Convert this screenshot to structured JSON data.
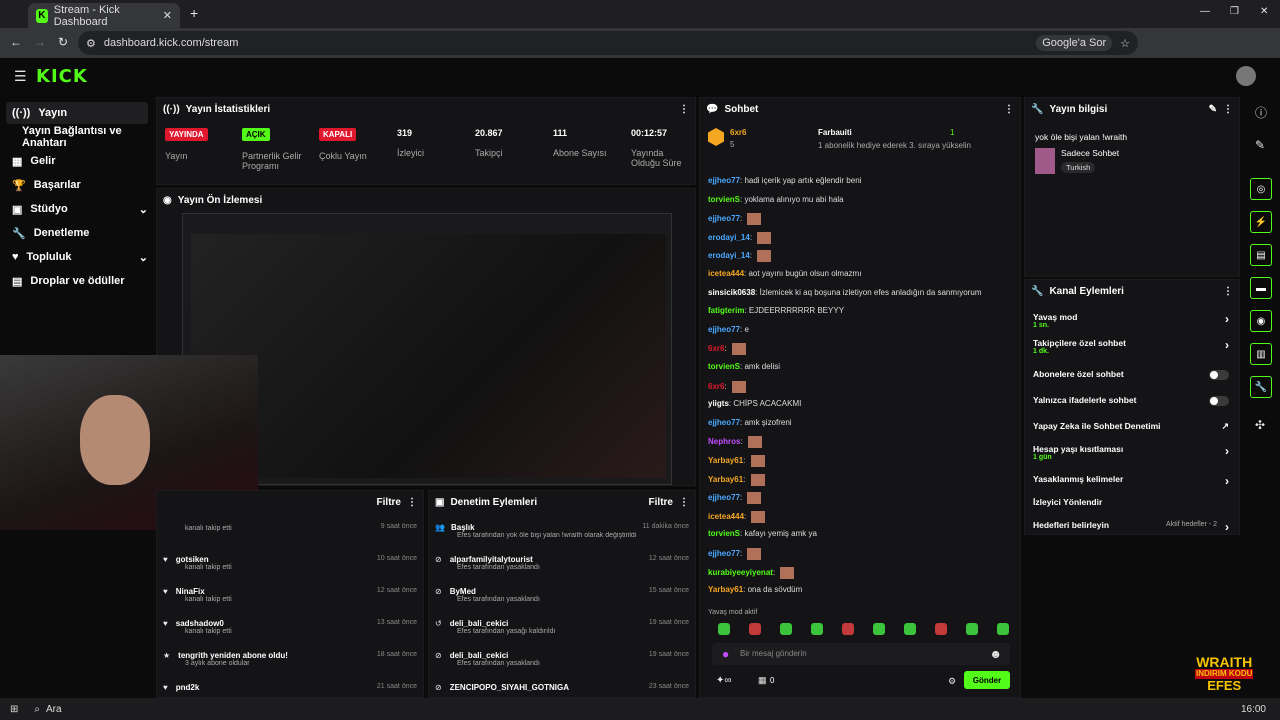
{
  "browser": {
    "tab_title": "Stream - Kick Dashboard",
    "url": "dashboard.kick.com/stream",
    "google_btn": "Google'a Sor"
  },
  "logo": "KICK",
  "sidebar": {
    "items": [
      {
        "label": "Yayın"
      },
      {
        "label": "Yayın Bağlantısı ve Anahtarı"
      },
      {
        "label": "Gelir"
      },
      {
        "label": "Başarılar"
      },
      {
        "label": "Stüdyo"
      },
      {
        "label": "Denetleme"
      },
      {
        "label": "Topluluk"
      },
      {
        "label": "Droplar ve ödüller"
      }
    ]
  },
  "stats": {
    "title": "Yayın İstatistikleri",
    "items": [
      {
        "badge": "YAYINDA",
        "label": "Yayın"
      },
      {
        "badge": "AÇIK",
        "label": "Partnerlik Gelir Programı"
      },
      {
        "badge": "KAPALI",
        "label": "Çoklu Yayın"
      },
      {
        "value": "319",
        "label": "İzleyici"
      },
      {
        "value": "20.867",
        "label": "Takipçi"
      },
      {
        "value": "111",
        "label": "Abone Sayısı"
      },
      {
        "value": "00:12:57",
        "label": "Yayında Olduğu Süre"
      }
    ]
  },
  "preview": {
    "title": "Yayın Ön İzlemesi"
  },
  "activity": {
    "filter": "Filtre",
    "items": [
      {
        "title": "",
        "sub": "kanalı takip etti",
        "time": "9 saat önce"
      },
      {
        "title": "gotsiken",
        "sub": "kanalı takip etti",
        "time": "10 saat önce"
      },
      {
        "title": "NinaFix",
        "sub": "kanalı takip etti",
        "time": "12 saat önce"
      },
      {
        "title": "sadshadow0",
        "sub": "kanalı takip etti",
        "time": "13 saat önce"
      },
      {
        "title": "tengrith yeniden abone oldu!",
        "sub": "3 aylık abone oldular",
        "time": "18 saat önce"
      },
      {
        "title": "pnd2k",
        "sub": "",
        "time": "21 saat önce"
      }
    ]
  },
  "moderation": {
    "title": "Denetim Eylemleri",
    "filter": "Filtre",
    "items": [
      {
        "title": "Başlık",
        "sub": "Efes tarafından yok öle bişi yalan !wraith olarak değiştirildi",
        "time": "11 dakika önce"
      },
      {
        "title": "alparfamilyitalytourist",
        "sub": "Efes tarafından yasaklandı",
        "time": "12 saat önce"
      },
      {
        "title": "ByMed",
        "sub": "Efes tarafından yasaklandı",
        "time": "15 saat önce"
      },
      {
        "title": "deli_bali_cekici",
        "sub": "Efes tarafından yasağı kaldırıldı",
        "time": "19 saat önce"
      },
      {
        "title": "deli_bali_cekici",
        "sub": "Efes tarafından yasaklandı",
        "time": "19 saat önce"
      },
      {
        "title": "ZENCIPOPO_SIYAHI_GOTNIGA",
        "sub": "",
        "time": "23 saat önce"
      }
    ]
  },
  "chat": {
    "title": "Sohbet",
    "pin_user": "6xr6",
    "pin_count": "5",
    "pin_user2": "Farbauiti",
    "pin_rank": "1",
    "pin_text": "1 abonelik hediye ederek 3. sıraya yükselin",
    "messages": [
      {
        "user": "ejjheo77",
        "text": "hadi içerik yap artık eğlendir beni"
      },
      {
        "user": "torvienS",
        "text": "yoklama alınıyo mu abi hala"
      },
      {
        "user": "ejjheo77",
        "text": ""
      },
      {
        "user": "erodayi_14",
        "text": ""
      },
      {
        "user": "erodayi_14",
        "text": ""
      },
      {
        "user": "icetea444",
        "text": "aot yayını bugün olsun olmazmı"
      },
      {
        "user": "sinsicik0638",
        "text": "İzlemicek ki aq boşuna izletiyon efes anladığın da sanmıyorum"
      },
      {
        "user": "fatigterim",
        "text": "EJDEERRRRRRR BEYYY"
      },
      {
        "user": "ejjheo77",
        "text": "e"
      },
      {
        "user": "6xr6",
        "text": ""
      },
      {
        "user": "torvienS",
        "text": "amk delisi"
      },
      {
        "user": "6xr6",
        "text": ""
      },
      {
        "user": "yiigts",
        "text": "CHİPS ACACAKMI"
      },
      {
        "user": "ejjheo77",
        "text": "amk şizofreni"
      },
      {
        "user": "Nephros",
        "text": ""
      },
      {
        "user": "Yarbay61",
        "text": ""
      },
      {
        "user": "Yarbay61",
        "text": ""
      },
      {
        "user": "ejjheo77",
        "text": ""
      },
      {
        "user": "icetea444",
        "text": ""
      },
      {
        "user": "torvienS",
        "text": "kafayı yemiş amk ya"
      },
      {
        "user": "ejjheo77",
        "text": ""
      },
      {
        "user": "kurabiyeeyiyenat",
        "text": ""
      },
      {
        "user": "Yarbay61",
        "text": "ona da sövdüm"
      }
    ],
    "slow_mode": "Yavaş mod aktif",
    "placeholder": "Bir mesaj gönderin",
    "send": "Gönder",
    "points": "0"
  },
  "info": {
    "title": "Yayın bilgisi",
    "stream_title": "yok öle bişi yalan !wraith",
    "category": "Sadece Sohbet",
    "lang": "Turkish"
  },
  "actions": {
    "title": "Kanal Eylemleri",
    "items": [
      {
        "label": "Yavaş mod",
        "sub": "1 sn."
      },
      {
        "label": "Takipçilere özel sohbet",
        "sub": "1 dk."
      },
      {
        "label": "Abonelere özel sohbet",
        "sub": ""
      },
      {
        "label": "Yalnızca ifadelerle sohbet",
        "sub": ""
      },
      {
        "label": "Yapay Zeka ile Sohbet Denetimi",
        "sub": ""
      },
      {
        "label": "Hesap yaşı kısıtlaması",
        "sub": "1 gün"
      },
      {
        "label": "Yasaklanmış kelimeler",
        "sub": ""
      },
      {
        "label": "İzleyici Yönlendir",
        "sub": ""
      },
      {
        "label": "Hedefleri belirleyin",
        "sub": ""
      }
    ],
    "goal_text": "Aktif hedefler - 2"
  },
  "taskbar": {
    "search": "Ara",
    "time": "16:00"
  },
  "overlay": {
    "text1": "WRAITH",
    "text2": "INDIRIM KODU",
    "text3": "EFES"
  },
  "colors": {
    "accent": "#53fc18",
    "live": "#e0182d"
  }
}
